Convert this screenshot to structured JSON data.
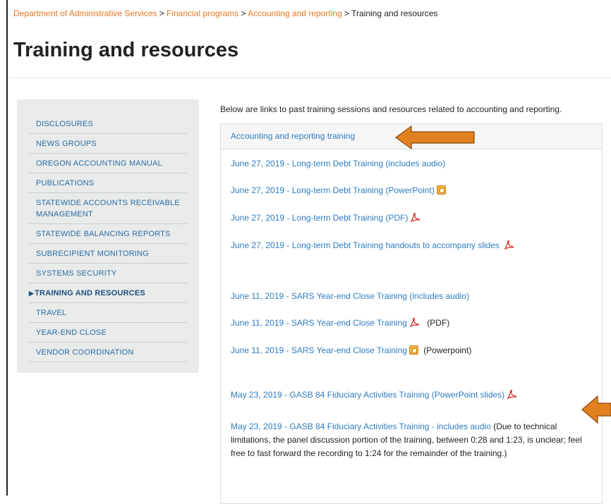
{
  "breadcrumb": {
    "items": [
      "Department of Administrative Services",
      "Financial programs",
      "Accounting and reporting"
    ],
    "separator": ">",
    "current": "Training and resources"
  },
  "page_title": "Training and resources",
  "sidebar": {
    "items": [
      {
        "label": "DISCLOSURES"
      },
      {
        "label": "NEWS GROUPS"
      },
      {
        "label": "OREGON ACCOUNTING MANUAL"
      },
      {
        "label": "PUBLICATIONS"
      },
      {
        "label": "STATEWIDE ACCOUNTS RECEIVABLE MANAGEMENT"
      },
      {
        "label": "STATEWIDE BALANCING REPORTS"
      },
      {
        "label": "SUBRECIPIENT MONITORING"
      },
      {
        "label": "SYSTEMS SECURITY"
      },
      {
        "label": "TRAINING AND RESOURCES",
        "active": true
      },
      {
        "label": "TRAVEL"
      },
      {
        "label": "YEAR-END CLOSE"
      },
      {
        "label": "VENDOR COORDINATION"
      }
    ],
    "active_marker": "▶"
  },
  "intro_text": "Below are links to past training sessions and resources related to accounting and reporting.",
  "panel": {
    "heading": "Accounting and reporting training",
    "links": [
      {
        "text": "June 27, 2019 - Long-term Debt Training (includes audio)"
      },
      {
        "text": "June 27, 2019 - Long-term Debt Training (PowerPoint)",
        "icon": "powerpoint-icon"
      },
      {
        "text": "June 27, 2019 - Long-term Debt Training (PDF)",
        "icon": "pdf-icon"
      },
      {
        "text": "June 27, 2019 - Long-term Debt Training handouts to accompany slides",
        "icon": "pdf-icon"
      },
      {
        "text": "June 11, 2019 - SARS Year-end Close Training (includes audio)"
      },
      {
        "text": "June 11, 2019 - SARS Year-end Close Training",
        "icon": "pdf-icon",
        "suffix": "(PDF)"
      },
      {
        "text": "June 11, 2019 - SARS Year-end Close Training",
        "icon": "powerpoint-icon",
        "suffix": "(Powerpoint)"
      },
      {
        "text": "May 23, 2019 - GASB 84 Fiduciary Activities Training (PowerPoint slides)",
        "icon": "pdf-icon"
      }
    ],
    "last_item": {
      "link_text": "May 23, 2019 - GASB 84 Fiduciary Activities Training - includes audio",
      "note": " (Due to technical limitations, the panel discussion portion of the training, between 0:28 and 1:23, is unclear; feel free to fast forward the recording to 1:24 for the remainder of the training.)"
    }
  },
  "colors": {
    "breadcrumb_link": "#e87722",
    "content_link": "#2f7cc1",
    "sidebar_link": "#2b6ca3",
    "annotation_arrow": "#e0801f"
  }
}
